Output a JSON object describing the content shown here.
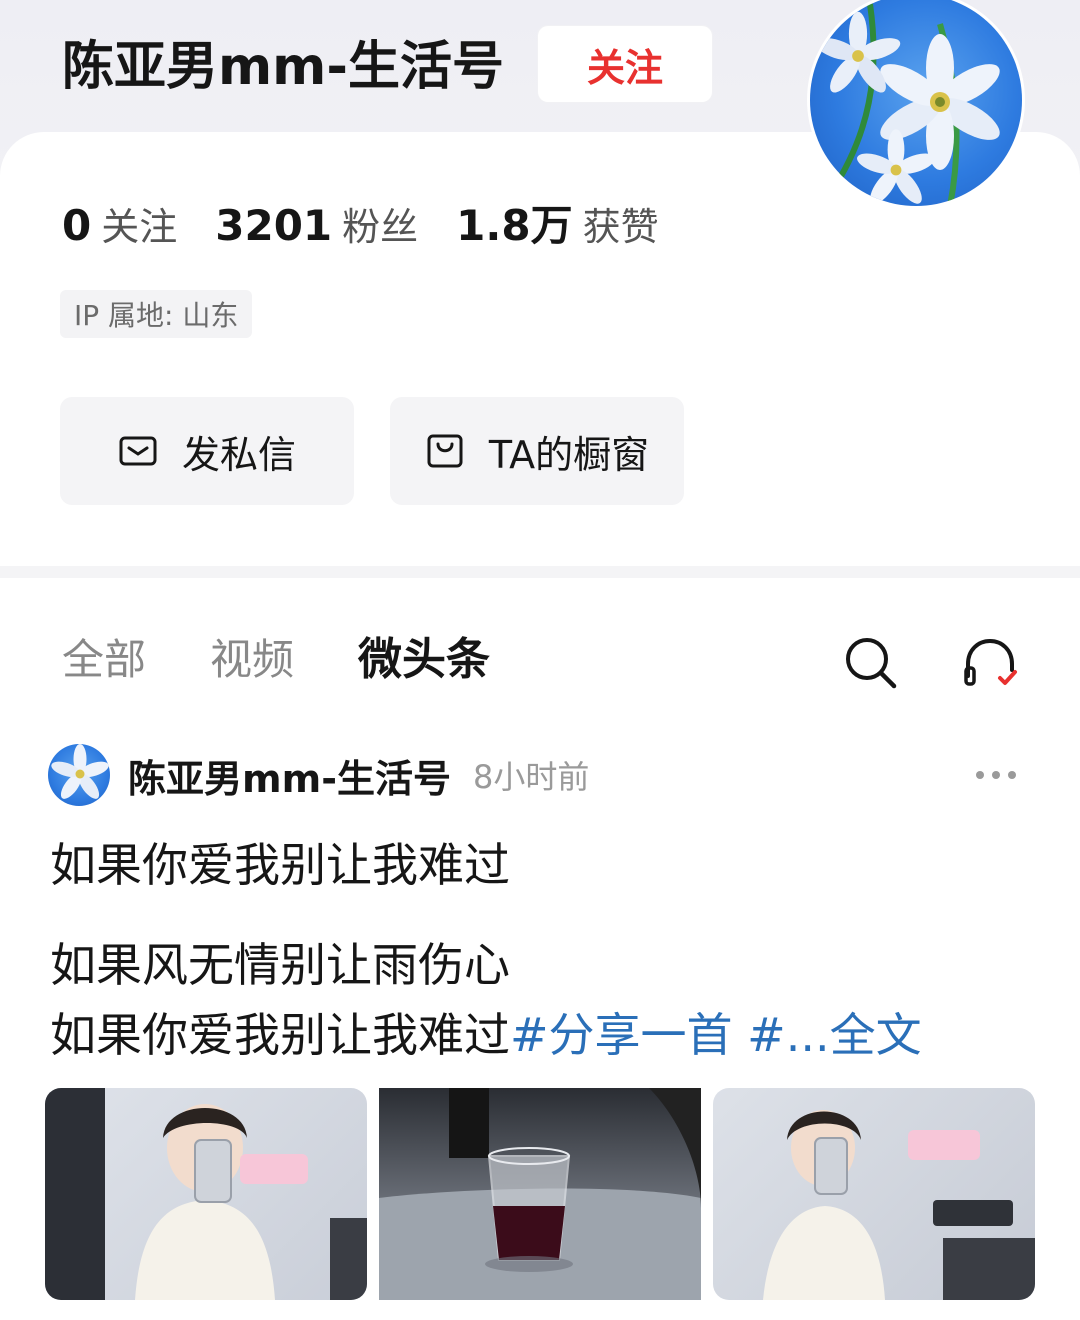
{
  "profile": {
    "name": "陈亚男mm-生活号",
    "follow_label": "关注",
    "stats": [
      {
        "num": "0",
        "label": "关注"
      },
      {
        "num": "3201",
        "label": "粉丝"
      },
      {
        "num": "1.8万",
        "label": "获赞"
      }
    ],
    "ip_location": "IP 属地: 山东",
    "actions": {
      "message_label": "发私信",
      "shop_label": "TA的橱窗"
    }
  },
  "tabs": {
    "all": "全部",
    "video": "视频",
    "micro": "微头条"
  },
  "post": {
    "author": "陈亚男mm-生活号",
    "time": "8小时前",
    "line1": "如果你爱我别让我难过",
    "line2": "如果风无情别让雨伤心",
    "line3_text": "如果你爱我别让我难过",
    "line3_tag": "#分享一首 #...全文"
  },
  "colors": {
    "follow_red": "#e8312f",
    "hashtag_blue": "#2a6fb8",
    "accent_check": "#e8312f"
  },
  "icons": {
    "message": "mail-icon",
    "shop": "shopping-bag-icon",
    "search": "search-icon",
    "listen": "headphones-icon",
    "more": "more-dots-icon"
  }
}
